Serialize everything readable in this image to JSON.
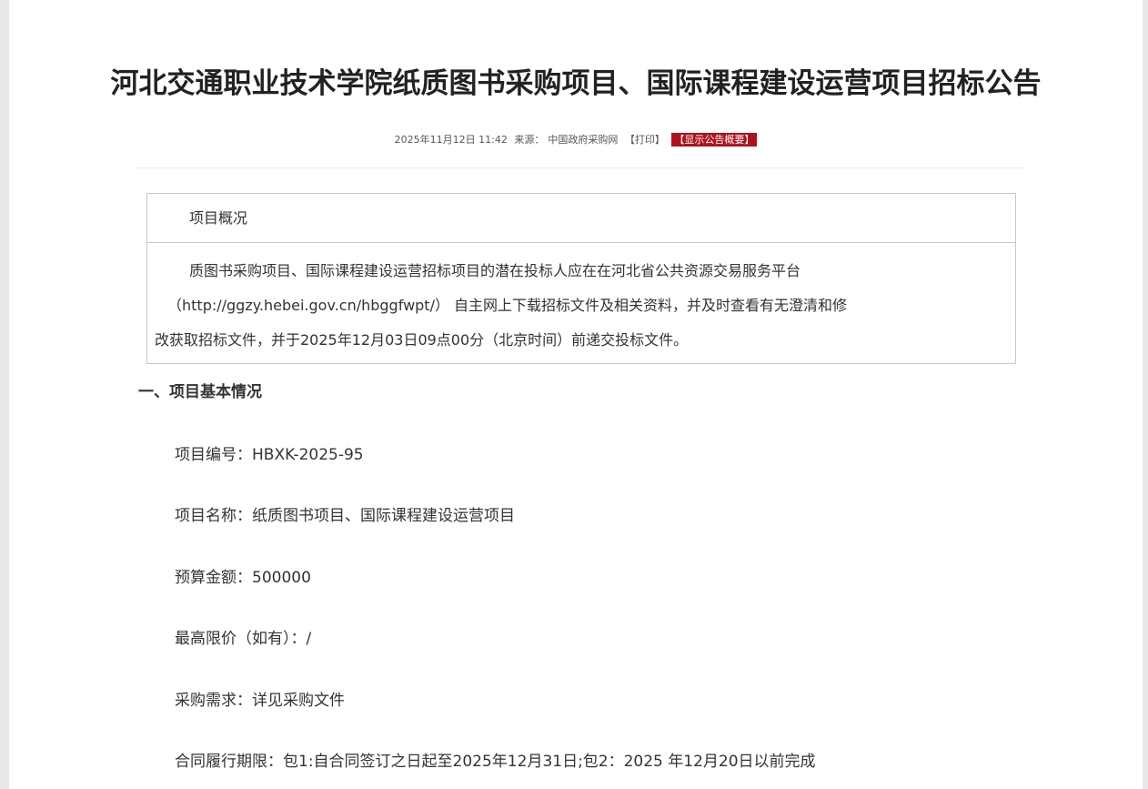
{
  "article": {
    "title": "河北交通职业技术学院纸质图书采购项目、国际课程建设运营项目招标公告",
    "meta": {
      "datetime": "2025年11月12日 11:42",
      "source_label": "来源：",
      "source": "中国政府采购网",
      "print_label": "【打印】",
      "summary_label": "【显示公告概要】"
    }
  },
  "overview": {
    "heading": "项目概况",
    "lines": [
      "质图书采购项目、国际课程建设运营招标项目的潜在投标人应在在河北省公共资源交易服务平台",
      "（http://ggzy.hebei.gov.cn/hbggfwpt/） 自主网上下载招标文件及相关资料，并及时查看有无澄清和修",
      "改获取招标文件，并于2025年12月03日09点00分（北京时间）前递交投标文件。"
    ]
  },
  "section1": {
    "title": "一、项目基本情况",
    "fields": [
      {
        "label": "项目编号：",
        "value": "HBXK-2025-95"
      },
      {
        "label": "项目名称：",
        "value": "纸质图书项目、国际课程建设运营项目"
      },
      {
        "label": "预算金额：",
        "value": "500000"
      },
      {
        "label": "最高限价（如有）：",
        "value": "/"
      },
      {
        "label": "采购需求：",
        "value": "详见采购文件"
      },
      {
        "label": "合同履行期限：",
        "value": "包1:自合同签订之日起至2025年12月31日;包2：2025 年12月20日以前完成"
      }
    ]
  }
}
